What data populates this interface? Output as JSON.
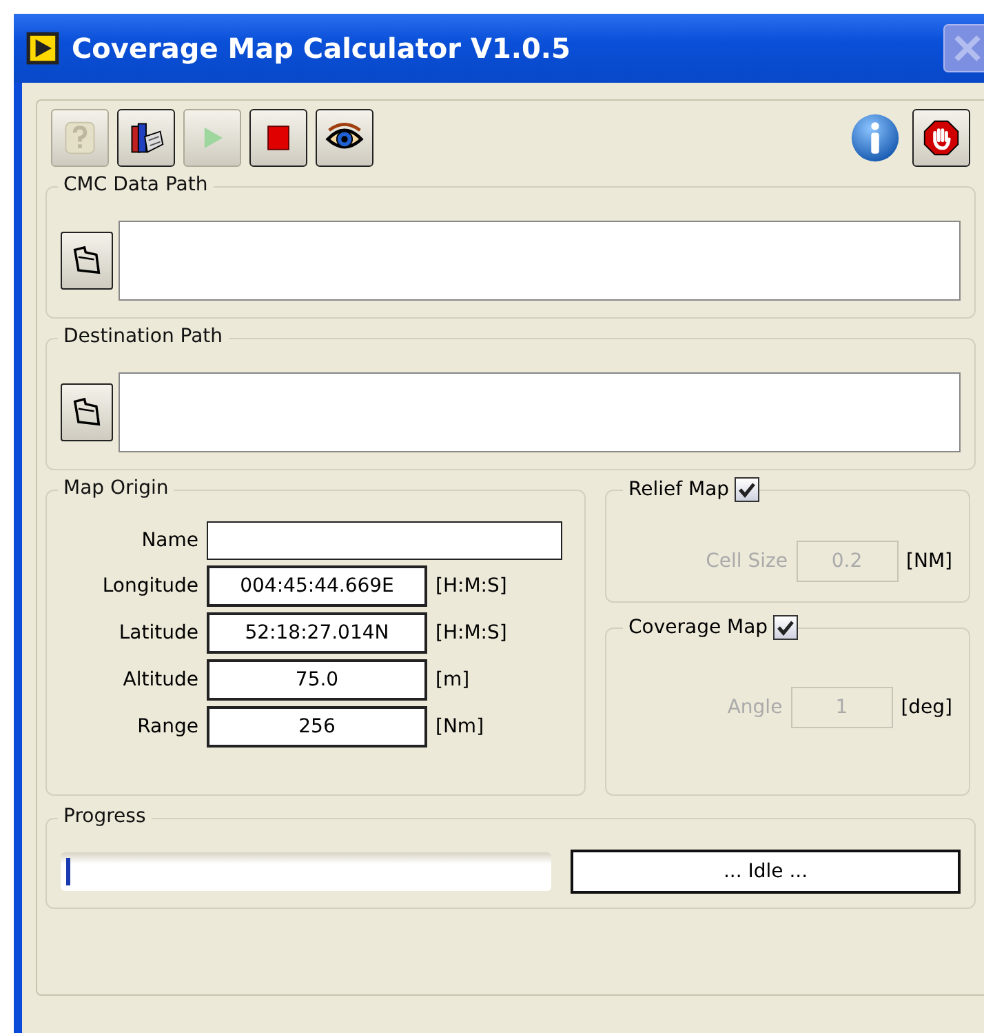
{
  "window": {
    "title": "Coverage Map Calculator V1.0.5"
  },
  "toolbar": {
    "left": [
      {
        "kind": "help",
        "disabled": true
      },
      {
        "kind": "book",
        "disabled": false
      },
      {
        "kind": "run",
        "disabled": true
      },
      {
        "kind": "stop",
        "disabled": false
      },
      {
        "kind": "eye",
        "disabled": false
      }
    ],
    "right": [
      {
        "kind": "info",
        "disabled": false
      },
      {
        "kind": "abort",
        "disabled": false
      }
    ]
  },
  "paths": [
    {
      "label": "CMC Data Path"
    },
    {
      "label": "Destination Path"
    }
  ],
  "map_origin": {
    "label": "Map Origin",
    "fields": [
      {
        "label": "Name"
      },
      {
        "label": "Longitude",
        "value": "004:45:44.669E",
        "unit": "[H:M:S]"
      },
      {
        "label": "Latitude",
        "value": "52:18:27.014N",
        "unit": "[H:M:S]"
      },
      {
        "label": "Altitude",
        "value": "75.0",
        "unit": "[m]"
      },
      {
        "label": "Range",
        "value": "256",
        "unit": "[Nm]"
      }
    ]
  },
  "options": [
    {
      "label": "Relief Map",
      "checked": true,
      "field": {
        "label": "Cell Size",
        "value": "0.2",
        "unit": "[NM]",
        "disabled": true
      }
    },
    {
      "label": "Coverage Map",
      "checked": true,
      "field": {
        "label": "Angle",
        "value": "1",
        "unit": "[deg]",
        "disabled": true
      }
    }
  ],
  "progress": {
    "label": "Progress",
    "level": 0.01,
    "status": "... Idle ..."
  }
}
